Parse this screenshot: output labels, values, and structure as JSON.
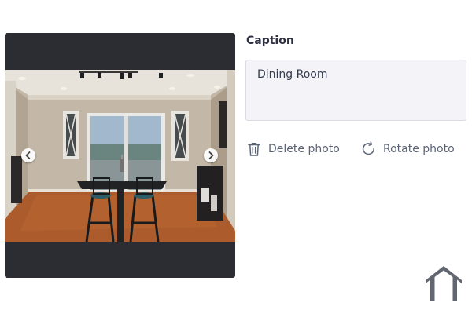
{
  "caption": {
    "label": "Caption",
    "value": "Dining Room"
  },
  "actions": {
    "delete_label": "Delete photo",
    "rotate_label": "Rotate photo"
  },
  "icons": {
    "prev": "chevron-left-icon",
    "next": "chevron-right-icon",
    "delete": "trash-icon",
    "rotate": "rotate-icon",
    "logo": "house-logo"
  },
  "colors": {
    "frame_background": "#2b2d33",
    "text_primary": "#2d3142",
    "text_secondary": "#5b6477",
    "input_background": "#f4f4f8",
    "logo": "#616670"
  }
}
